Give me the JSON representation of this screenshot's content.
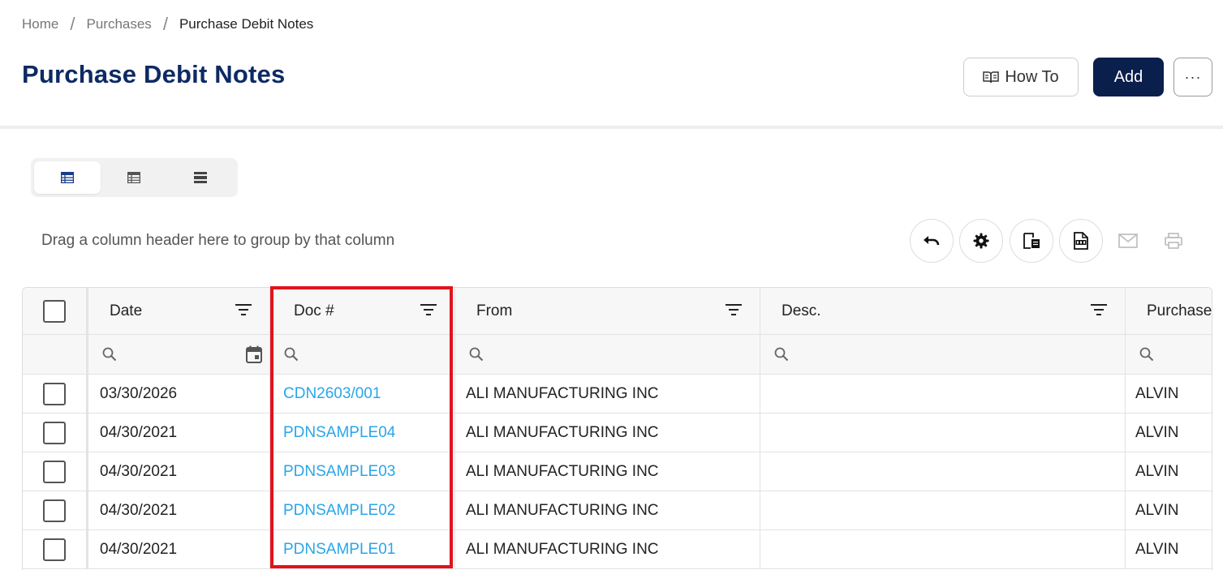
{
  "breadcrumb": {
    "home": "Home",
    "purchases": "Purchases",
    "current": "Purchase Debit Notes",
    "separator": "/"
  },
  "page": {
    "title": "Purchase Debit Notes"
  },
  "actions": {
    "howto_label": "How To",
    "add_label": "Add",
    "more_label": "···"
  },
  "view_modes": [
    "table-view",
    "compact-view",
    "list-view"
  ],
  "group_hint": "Drag a column header here to group by that column",
  "toolbar_icons": [
    "undo-icon",
    "gear-icon",
    "export-excel-icon",
    "export-pdf-icon",
    "mail-icon",
    "print-icon"
  ],
  "grid": {
    "columns": [
      "Date",
      "Doc #",
      "From",
      "Desc.",
      "Purchase"
    ],
    "rows": [
      {
        "date": "03/30/2026",
        "doc": "CDN2603/001",
        "from": "ALI MANUFACTURING INC",
        "desc": "",
        "purchaser": "ALVIN"
      },
      {
        "date": "04/30/2021",
        "doc": "PDNSAMPLE04",
        "from": "ALI MANUFACTURING INC",
        "desc": "",
        "purchaser": "ALVIN"
      },
      {
        "date": "04/30/2021",
        "doc": "PDNSAMPLE03",
        "from": "ALI MANUFACTURING INC",
        "desc": "",
        "purchaser": "ALVIN"
      },
      {
        "date": "04/30/2021",
        "doc": "PDNSAMPLE02",
        "from": "ALI MANUFACTURING INC",
        "desc": "",
        "purchaser": "ALVIN"
      },
      {
        "date": "04/30/2021",
        "doc": "PDNSAMPLE01",
        "from": "ALI MANUFACTURING INC",
        "desc": "",
        "purchaser": "ALVIN"
      }
    ]
  },
  "colors": {
    "title": "#0d2a63",
    "add_button": "#0b1f4d",
    "link": "#29a6e8",
    "highlight": "#e0141b"
  }
}
